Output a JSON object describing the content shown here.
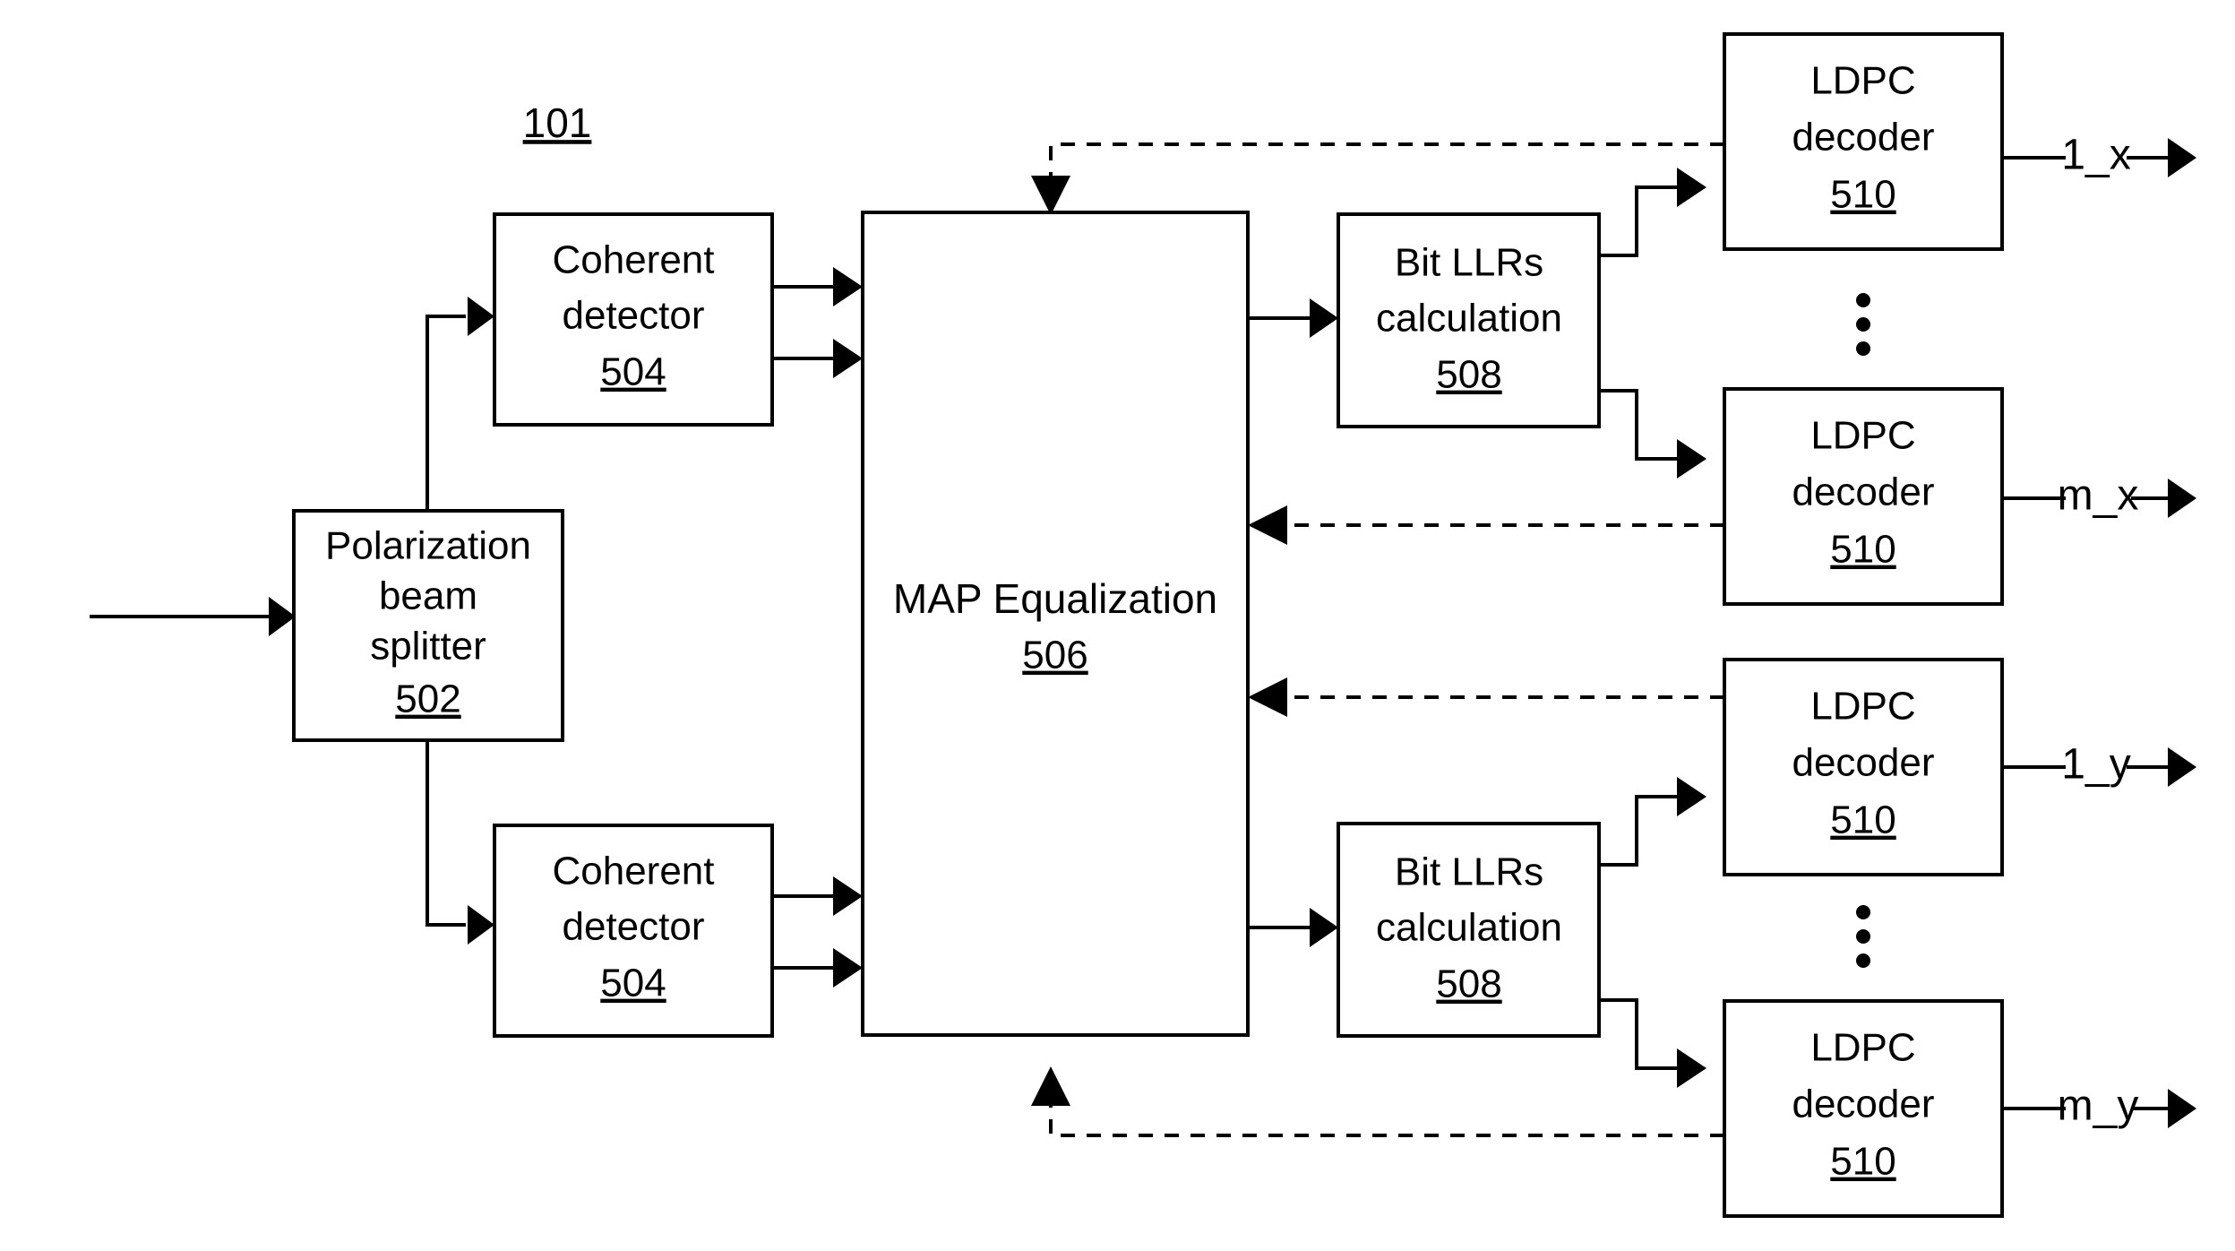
{
  "figure": {
    "reference_label": "101",
    "description": "Block diagram of a coherent optical receiver with MAP equalization and LDPC decoding"
  },
  "blocks": [
    {
      "id": "pbs",
      "lines": [
        "Polarization",
        "beam",
        "splitter"
      ],
      "ref": "502"
    },
    {
      "id": "coherent-detector-top",
      "lines": [
        "Coherent",
        "detector"
      ],
      "ref": "504"
    },
    {
      "id": "coherent-detector-bottom",
      "lines": [
        "Coherent",
        "detector"
      ],
      "ref": "504"
    },
    {
      "id": "map-equalization",
      "lines": [
        "MAP Equalization"
      ],
      "ref": "506"
    },
    {
      "id": "bit-llrs-top",
      "lines": [
        "Bit LLRs",
        "calculation"
      ],
      "ref": "508"
    },
    {
      "id": "bit-llrs-bottom",
      "lines": [
        "Bit LLRs",
        "calculation"
      ],
      "ref": "508"
    },
    {
      "id": "ldpc-decoder-1x",
      "lines": [
        "LDPC",
        "decoder"
      ],
      "ref": "510"
    },
    {
      "id": "ldpc-decoder-mx",
      "lines": [
        "LDPC",
        "decoder"
      ],
      "ref": "510"
    },
    {
      "id": "ldpc-decoder-1y",
      "lines": [
        "LDPC",
        "decoder"
      ],
      "ref": "510"
    },
    {
      "id": "ldpc-decoder-my",
      "lines": [
        "LDPC",
        "decoder"
      ],
      "ref": "510"
    }
  ],
  "outputs": [
    {
      "id": "out-1x",
      "label": "1_x"
    },
    {
      "id": "out-mx",
      "label": "m_x"
    },
    {
      "id": "out-1y",
      "label": "1_y"
    },
    {
      "id": "out-my",
      "label": "m_y"
    }
  ],
  "ellipses": [
    {
      "id": "ellipsis-x",
      "glyph": "⋮"
    },
    {
      "id": "ellipsis-y",
      "glyph": "⋮"
    }
  ],
  "colors": {
    "stroke": "#000000",
    "background": "#ffffff"
  }
}
